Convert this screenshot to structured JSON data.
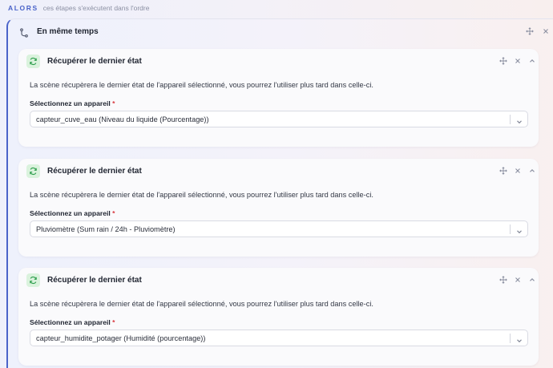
{
  "header": {
    "then_label": "ALORS",
    "then_subtitle": "ces étapes s'exécutent dans l'ordre"
  },
  "parallel": {
    "title": "En même temps",
    "icons": [
      "branch-icon",
      "move-icon"
    ]
  },
  "cards": [
    {
      "title": "Récupérer le dernier état",
      "description": "La scène récupèrera le dernier état de l'appareil sélectionné, vous pourrez l'utiliser plus tard dans celle-ci.",
      "field_label": "Sélectionnez un appareil",
      "required_mark": "*",
      "selected_value": "capteur_cuve_eau (Niveau du liquide (Pourcentage))"
    },
    {
      "title": "Récupérer le dernier état",
      "description": "La scène récupèrera le dernier état de l'appareil sélectionné, vous pourrez l'utiliser plus tard dans celle-ci.",
      "field_label": "Sélectionnez un appareil",
      "required_mark": "*",
      "selected_value": "Pluviomètre (Sum rain / 24h - Pluviomètre)"
    },
    {
      "title": "Récupérer le dernier état",
      "description": "La scène récupèrera le dernier état de l'appareil sélectionné, vous pourrez l'utiliser plus tard dans celle-ci.",
      "field_label": "Sélectionnez un appareil",
      "required_mark": "*",
      "selected_value": "capteur_humidite_potager (Humidité (pourcentage))"
    }
  ],
  "colors": {
    "accent": "#4a63c9",
    "card_icon_bg": "#daf2dd",
    "card_icon_fg": "#2c9e4c",
    "required": "#d8383f"
  }
}
